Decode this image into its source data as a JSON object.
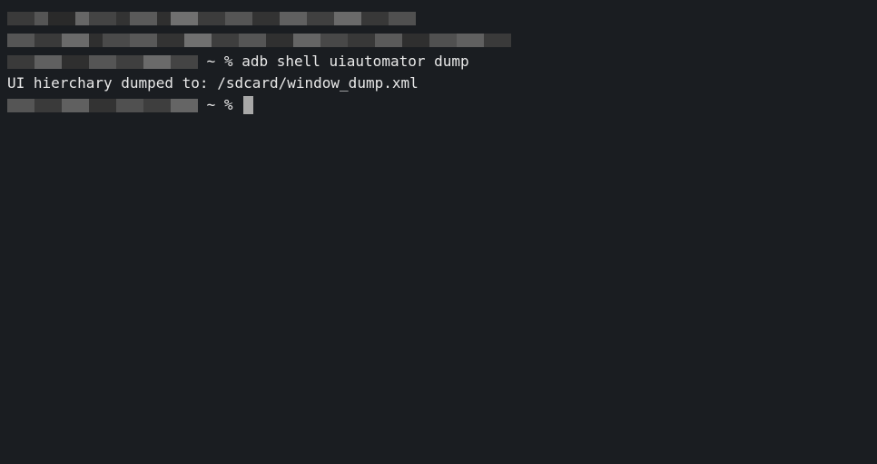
{
  "terminal": {
    "lines": [
      {
        "type": "redacted_header"
      },
      {
        "type": "redacted_header"
      },
      {
        "type": "prompt_command",
        "prompt": "~ %",
        "command": "adb shell uiautomator dump"
      },
      {
        "type": "output",
        "text": "UI hierchary dumped to: /sdcard/window_dump.xml"
      },
      {
        "type": "prompt_cursor",
        "prompt": "~ %"
      }
    ]
  }
}
